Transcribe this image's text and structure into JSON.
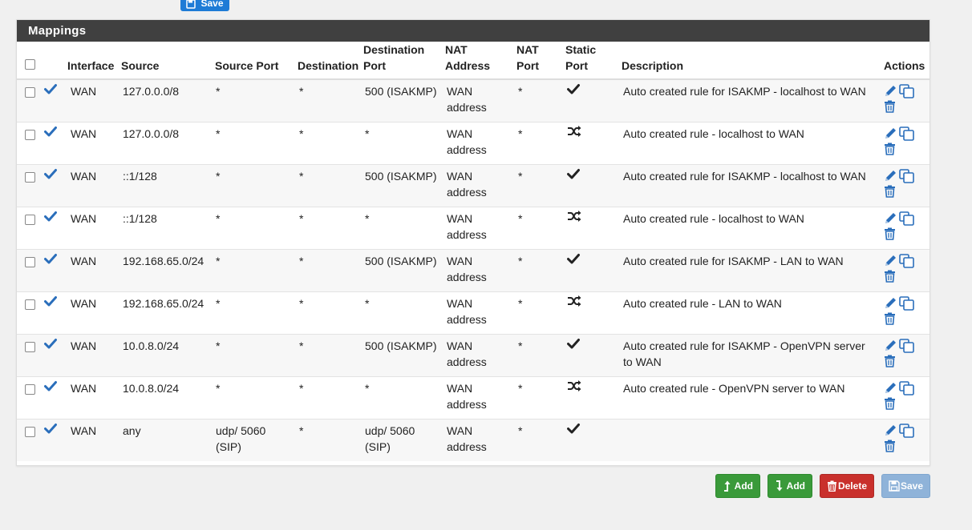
{
  "top_save": {
    "label": "Save"
  },
  "panel": {
    "title": "Mappings"
  },
  "columns": {
    "interface": "Interface",
    "source": "Source",
    "source_port": "Source Port",
    "destination": "Destination",
    "destination_port_1": "Destination",
    "destination_port_2": "Port",
    "nat_address_1": "NAT",
    "nat_address_2": "Address",
    "nat_port_1": "NAT",
    "nat_port_2": "Port",
    "static_port_1": "Static",
    "static_port_2": "Port",
    "description": "Description",
    "actions": "Actions"
  },
  "rows": [
    {
      "interface": "WAN",
      "source": "127.0.0.0/8",
      "source_port": "*",
      "destination": "*",
      "destination_port": "500 (ISAKMP)",
      "nat_address_1": "WAN",
      "nat_address_2": "address",
      "nat_port": "*",
      "static_port": "check",
      "description": "Auto created rule for ISAKMP - localhost to WAN"
    },
    {
      "interface": "WAN",
      "source": "127.0.0.0/8",
      "source_port": "*",
      "destination": "*",
      "destination_port": "*",
      "nat_address_1": "WAN",
      "nat_address_2": "address",
      "nat_port": "*",
      "static_port": "random",
      "description": "Auto created rule - localhost to WAN"
    },
    {
      "interface": "WAN",
      "source": "::1/128",
      "source_port": "*",
      "destination": "*",
      "destination_port": "500 (ISAKMP)",
      "nat_address_1": "WAN",
      "nat_address_2": "address",
      "nat_port": "*",
      "static_port": "check",
      "description": "Auto created rule for ISAKMP - localhost to WAN"
    },
    {
      "interface": "WAN",
      "source": "::1/128",
      "source_port": "*",
      "destination": "*",
      "destination_port": "*",
      "nat_address_1": "WAN",
      "nat_address_2": "address",
      "nat_port": "*",
      "static_port": "random",
      "description": "Auto created rule - localhost to WAN"
    },
    {
      "interface": "WAN",
      "source": "192.168.65.0/24",
      "source_port": "*",
      "destination": "*",
      "destination_port": "500 (ISAKMP)",
      "nat_address_1": "WAN",
      "nat_address_2": "address",
      "nat_port": "*",
      "static_port": "check",
      "description": "Auto created rule for ISAKMP - LAN to WAN"
    },
    {
      "interface": "WAN",
      "source": "192.168.65.0/24",
      "source_port": "*",
      "destination": "*",
      "destination_port": "*",
      "nat_address_1": "WAN",
      "nat_address_2": "address",
      "nat_port": "*",
      "static_port": "random",
      "description": "Auto created rule - LAN to WAN"
    },
    {
      "interface": "WAN",
      "source": "10.0.8.0/24",
      "source_port": "*",
      "destination": "*",
      "destination_port": "500 (ISAKMP)",
      "nat_address_1": "WAN",
      "nat_address_2": "address",
      "nat_port": "*",
      "static_port": "check",
      "description": "Auto created rule for ISAKMP - OpenVPN server to WAN"
    },
    {
      "interface": "WAN",
      "source": "10.0.8.0/24",
      "source_port": "*",
      "destination": "*",
      "destination_port": "*",
      "nat_address_1": "WAN",
      "nat_address_2": "address",
      "nat_port": "*",
      "static_port": "random",
      "description": "Auto created rule - OpenVPN server to WAN"
    },
    {
      "interface": "WAN",
      "source": "any",
      "source_port": "udp/ 5060 (SIP)",
      "destination": "*",
      "destination_port": "udp/ 5060 (SIP)",
      "nat_address_1": "WAN",
      "nat_address_2": "address",
      "nat_port": "*",
      "static_port": "check",
      "description": ""
    }
  ],
  "buttons": {
    "add_top": "Add",
    "add_bottom": "Add",
    "delete": "Delete",
    "save": "Save"
  },
  "colors": {
    "icon_blue": "#2a6ebb",
    "heading_bg": "#404040",
    "green": "#3a9a3a",
    "red": "#c9302c",
    "save_disabled": "#8fb3d9",
    "save_top": "#1e7bd6"
  }
}
